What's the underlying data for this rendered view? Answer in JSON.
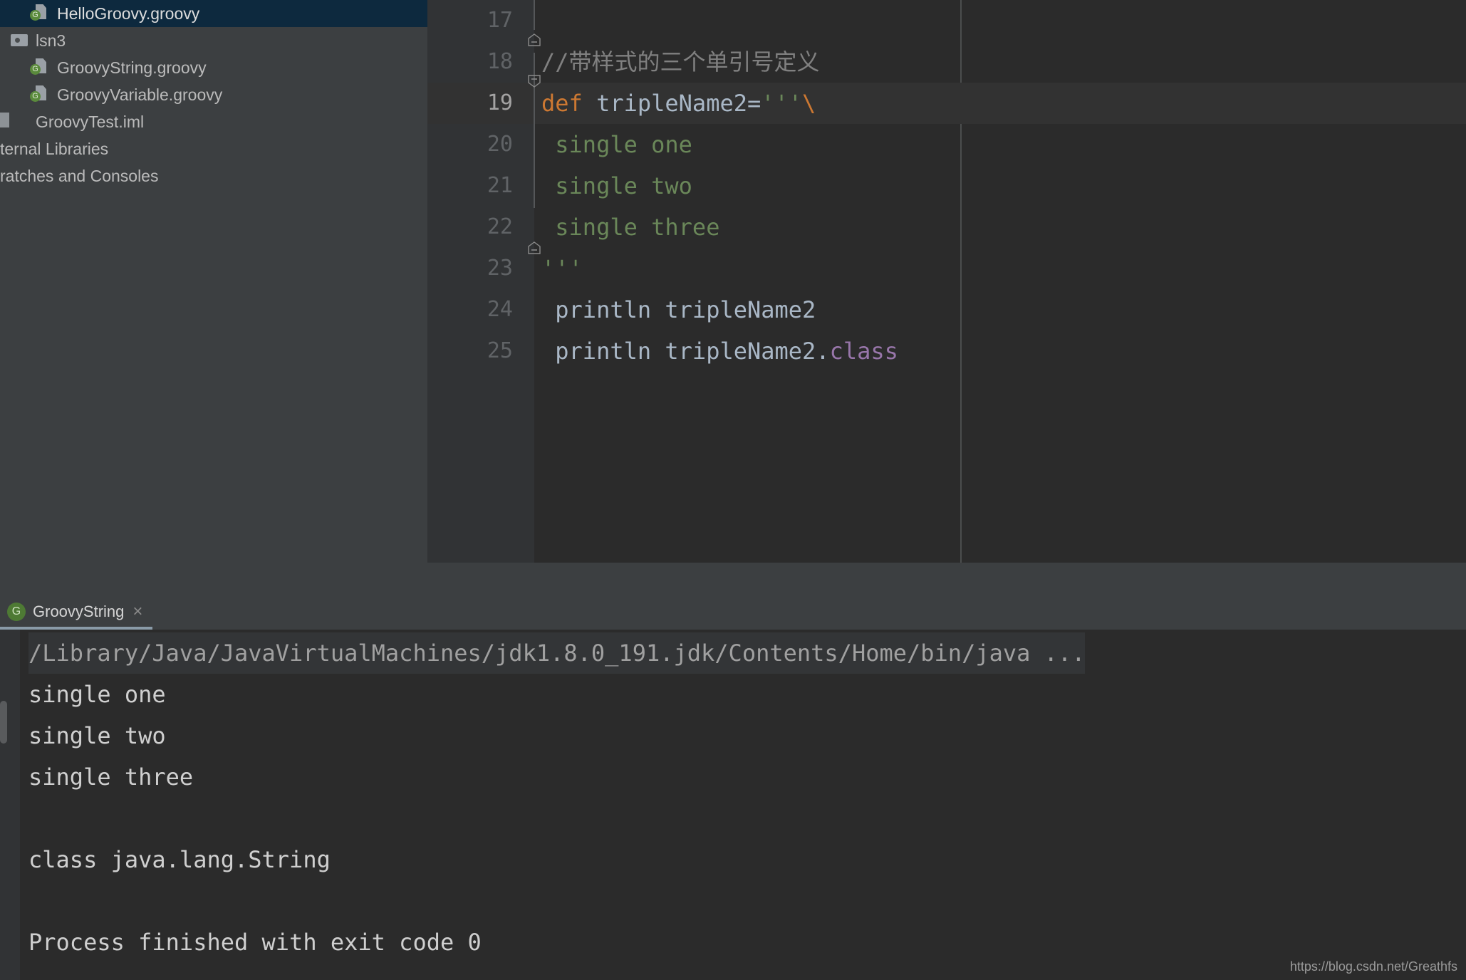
{
  "project_tree": {
    "items": [
      {
        "label": "HelloGroovy.groovy",
        "icon": "groovy-file-icon",
        "indent": 2,
        "selected": true
      },
      {
        "label": "lsn3",
        "icon": "folder-icon",
        "indent": 1,
        "selected": false
      },
      {
        "label": "GroovyString.groovy",
        "icon": "groovy-file-icon",
        "indent": 2,
        "selected": false
      },
      {
        "label": "GroovyVariable.groovy",
        "icon": "groovy-file-icon",
        "indent": 2,
        "selected": false
      },
      {
        "label": "GroovyTest.iml",
        "icon": "iml-file-icon",
        "indent": 1,
        "selected": false
      },
      {
        "label": "ternal Libraries",
        "icon": "none",
        "indent": 0,
        "selected": false
      },
      {
        "label": "ratches and Consoles",
        "icon": "none",
        "indent": 0,
        "selected": false
      }
    ]
  },
  "editor": {
    "lines": [
      {
        "number": "17",
        "text": "",
        "current": false
      },
      {
        "number": "18",
        "text": "//带样式的三个单引号定义",
        "current": false
      },
      {
        "number": "19",
        "text": "def tripleName2='''\\",
        "current": true
      },
      {
        "number": "20",
        "text": " single one",
        "current": false
      },
      {
        "number": "21",
        "text": " single two",
        "current": false
      },
      {
        "number": "22",
        "text": " single three",
        "current": false
      },
      {
        "number": "23",
        "text": "'''",
        "current": false
      },
      {
        "number": "24",
        "text": " println tripleName2",
        "current": false
      },
      {
        "number": "25",
        "text": " println tripleName2.class",
        "current": false
      }
    ],
    "tokens": {
      "line18": [
        {
          "t": "//带样式的三个单引号定义",
          "c": "t-comment"
        }
      ],
      "line19": [
        {
          "t": "def",
          "c": "t-keyword"
        },
        {
          "t": " tripleName2=",
          "c": "t-default"
        },
        {
          "t": "'''",
          "c": "t-string"
        },
        {
          "t": "\\",
          "c": "t-keyword"
        }
      ],
      "line20": [
        {
          "t": "single one",
          "c": "t-string"
        }
      ],
      "line21": [
        {
          "t": "single two",
          "c": "t-string"
        }
      ],
      "line22": [
        {
          "t": "single three",
          "c": "t-string"
        }
      ],
      "line23": [
        {
          "t": "'''",
          "c": "t-string"
        }
      ],
      "line24": [
        {
          "t": "println tripleName2",
          "c": "t-default"
        }
      ],
      "line25": [
        {
          "t": "println tripleName2.",
          "c": "t-default"
        },
        {
          "t": "class",
          "c": "t-field"
        }
      ]
    },
    "colors": {
      "background": "#2b2b2b",
      "gutter": "#313335",
      "current_line": "#323232",
      "keyword": "#cc7832",
      "string": "#6a8759",
      "comment": "#808080",
      "identifier": "#a9b7c6",
      "field": "#9876aa"
    }
  },
  "run_window": {
    "tab": {
      "icon": "groovy-run-icon",
      "label": "GroovyString",
      "close_label": "×"
    },
    "console": {
      "command_line": "/Library/Java/JavaVirtualMachines/jdk1.8.0_191.jdk/Contents/Home/bin/java ...",
      "output_lines": [
        "single one",
        "single two",
        "single three",
        "",
        "class java.lang.String",
        "",
        "Process finished with exit code 0"
      ]
    }
  },
  "watermark": {
    "text": "https://blog.csdn.net/Greathfs"
  }
}
